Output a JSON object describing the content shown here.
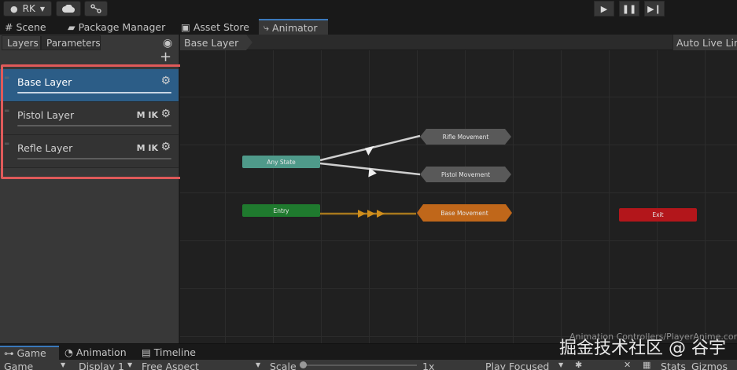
{
  "toolbar": {
    "account": "RK",
    "cloud_icon": "cloud-icon",
    "collab_icon": "branch-icon",
    "play_icon": "play-icon",
    "pause_icon": "pause-icon",
    "step_icon": "step-icon"
  },
  "tabs": [
    {
      "label": "Scene",
      "icon": "grid-icon"
    },
    {
      "label": "Package Manager",
      "icon": "package-icon"
    },
    {
      "label": "Asset Store",
      "icon": "store-icon"
    },
    {
      "label": "Animator",
      "icon": "animator-icon"
    }
  ],
  "left_panel": {
    "tabs": [
      "Layers",
      "Parameters"
    ],
    "add_label": "+",
    "layers": [
      {
        "name": "Base Layer",
        "tags": ""
      },
      {
        "name": "Pistol Layer",
        "tags": "M IK"
      },
      {
        "name": "Refle Layer",
        "tags": "M IK"
      }
    ]
  },
  "graph": {
    "breadcrumb": "Base Layer",
    "auto_live_link": "Auto Live Link",
    "footer_path": "Animation Controllers/PlayerAnime.controlle",
    "states": {
      "rifle": "Rifle Movement",
      "pistol": "Pistol Movement",
      "any": "Any State",
      "entry": "Entry",
      "base": "Base Movement",
      "exit": "Exit"
    },
    "colors": {
      "any_state": "#4f9a8a",
      "entry": "#1f7a2e",
      "default_state": "#c0671a",
      "exit": "#b3161b",
      "state": "#5b5b5b"
    }
  },
  "bottom_tabs": [
    {
      "label": "Game",
      "icon": "gamepad-icon"
    },
    {
      "label": "Animation",
      "icon": "animation-icon"
    },
    {
      "label": "Timeline",
      "icon": "timeline-icon"
    }
  ],
  "bottom_toolbar": {
    "view": "Game",
    "display": "Display 1",
    "aspect": "Free Aspect",
    "scale_label": "Scale",
    "scale_value": "1x",
    "play_mode": "Play Focused",
    "stats": "Stats",
    "gizmos": "Gizmos"
  },
  "watermark": "掘金技术社区 @ 谷宇"
}
